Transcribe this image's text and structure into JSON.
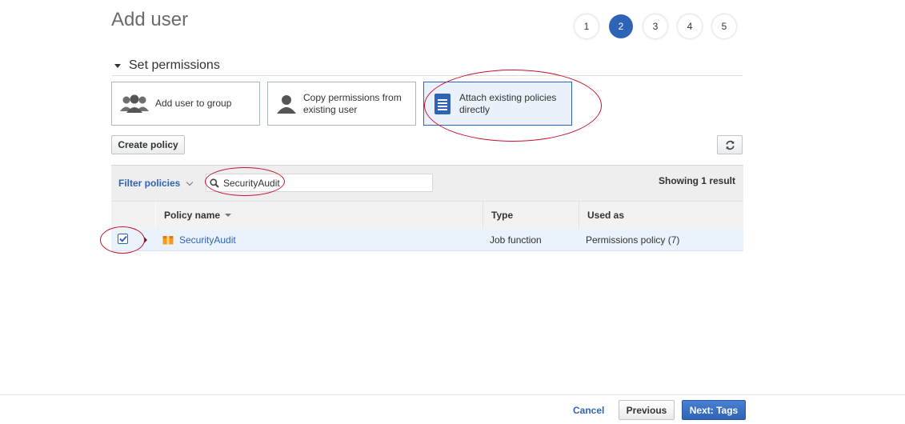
{
  "header": {
    "title": "Add user",
    "steps": [
      "1",
      "2",
      "3",
      "4",
      "5"
    ],
    "active_step": "2"
  },
  "section": {
    "title": "Set permissions"
  },
  "options": {
    "add_to_group": "Add user to group",
    "copy_permissions": "Copy permissions from existing user",
    "attach_policies": "Attach existing policies directly",
    "selected": "attach_policies"
  },
  "toolbar": {
    "create_policy": "Create policy"
  },
  "filter": {
    "label": "Filter policies",
    "search_value": "SecurityAudit",
    "result_text": "Showing 1 result"
  },
  "table": {
    "columns": {
      "name": "Policy name",
      "type": "Type",
      "used_as": "Used as"
    },
    "rows": [
      {
        "checked": true,
        "name": "SecurityAudit",
        "type": "Job function",
        "used_as": "Permissions policy (7)"
      }
    ]
  },
  "footer": {
    "cancel": "Cancel",
    "previous": "Previous",
    "next": "Next: Tags"
  },
  "colors": {
    "accent": "#2f63b5",
    "annotation": "#c8102e",
    "policy_icon": "#f59b1b"
  }
}
